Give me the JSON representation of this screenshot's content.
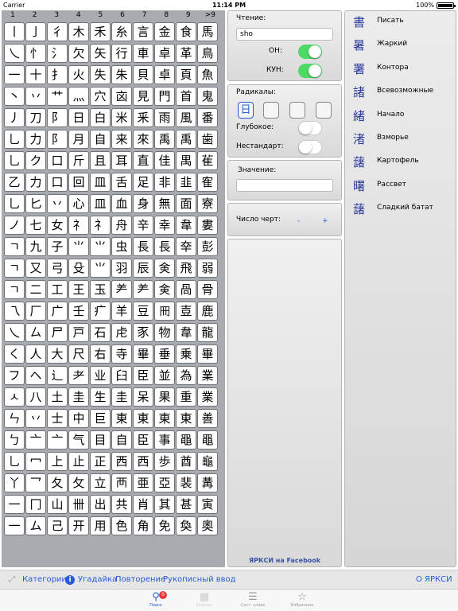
{
  "status": {
    "carrier": "Carrier",
    "time": "11:14 PM",
    "battery": "100%"
  },
  "stroke_header": [
    "1",
    "2",
    "3",
    "4",
    "5",
    "6",
    "7",
    "8",
    "9",
    ">9"
  ],
  "grid": [
    [
      "丨",
      "亅",
      "彳",
      "木",
      "禾",
      "糸",
      "言",
      "金",
      "食",
      "馬"
    ],
    [
      "乀",
      "忄",
      "氵",
      "欠",
      "矢",
      "行",
      "車",
      "卓",
      "革",
      "鳥"
    ],
    [
      "一",
      "十",
      "扌",
      "火",
      "失",
      "朱",
      "貝",
      "卓",
      "頁",
      "魚"
    ],
    [
      "丶",
      "丷",
      "艹",
      "灬",
      "穴",
      "㐫",
      "見",
      "門",
      "首",
      "鬼"
    ],
    [
      "丿",
      "刀",
      "阝",
      "日",
      "白",
      "米",
      "釆",
      "雨",
      "風",
      "番"
    ],
    [
      "乚",
      "力",
      "阝",
      "月",
      "自",
      "来",
      "來",
      "禹",
      "禹",
      "歯"
    ],
    [
      "乚",
      "ク",
      "口",
      "斤",
      "且",
      "耳",
      "直",
      "佳",
      "禺",
      "雈"
    ],
    [
      "乙",
      "力",
      "口",
      "回",
      "皿",
      "舌",
      "足",
      "非",
      "韭",
      "隺"
    ],
    [
      "乚",
      "匕",
      "丷",
      "心",
      "皿",
      "血",
      "身",
      "無",
      "面",
      "寮"
    ],
    [
      "ノ",
      "七",
      "女",
      "礻",
      "礻",
      "舟",
      "辛",
      "幸",
      "韋",
      "婁"
    ],
    [
      "ㄱ",
      "九",
      "子",
      "⺌",
      "⺌",
      "虫",
      "長",
      "長",
      "㚔",
      "彭"
    ],
    [
      "ㄱ",
      "又",
      "弓",
      "殳",
      "⺌",
      "羽",
      "辰",
      "㑒",
      "飛",
      "弱"
    ],
    [
      "ㄱ",
      "二",
      "工",
      "王",
      "玉",
      "⺶",
      "⺶",
      "㑒",
      "咼",
      "骨"
    ],
    [
      "乁",
      "厂",
      "广",
      "壬",
      "疒",
      "羊",
      "豆",
      "𠕁",
      "壴",
      "鹿"
    ],
    [
      "乀",
      "ㄙ",
      "尸",
      "戸",
      "石",
      "虍",
      "豕",
      "物",
      "韋",
      "龍"
    ],
    [
      "く",
      "人",
      "大",
      "尺",
      "右",
      "寺",
      "畢",
      "垂",
      "乗",
      "畢"
    ],
    [
      "フ",
      "ヘ",
      "辶",
      "耂",
      "业",
      "臼",
      "臣",
      "並",
      "為",
      "業"
    ],
    [
      "ㅅ",
      "八",
      "土",
      "圭",
      "生",
      "圭",
      "呆",
      "果",
      "重",
      "業"
    ],
    [
      "ㄣ",
      "丷",
      "士",
      "中",
      "巨",
      "東",
      "東",
      "東",
      "東",
      "善"
    ],
    [
      "ㄅ",
      "亠",
      "亠",
      "气",
      "目",
      "自",
      "臣",
      "事",
      "黽",
      "黽"
    ],
    [
      "乚",
      "冖",
      "上",
      "止",
      "正",
      "西",
      "西",
      "歩",
      "酋",
      "龜"
    ],
    [
      "丫",
      "乛",
      "夂",
      "攵",
      "立",
      "襾",
      "亜",
      "亞",
      "裴",
      "冓"
    ],
    [
      "一",
      "冂",
      "山",
      "卌",
      "出",
      "共",
      "肖",
      "其",
      "甚",
      "寅"
    ],
    [
      "一",
      "ム",
      "己",
      "开",
      "用",
      "色",
      "角",
      "免",
      "奐",
      "奧"
    ]
  ],
  "reading": {
    "label": "Чтение:",
    "value": "sho",
    "on_label": "ОН:",
    "kun_label": "КУН:"
  },
  "radicals": {
    "label": "Радикалы:",
    "slots": [
      "日",
      "",
      "",
      ""
    ],
    "deep_label": "Глубокое:",
    "nonstandard_label": "Нестандарт:"
  },
  "meaning": {
    "label": "Значение:",
    "value": ""
  },
  "strokes": {
    "label": "Число черт:",
    "minus": "-",
    "plus": "+"
  },
  "facebook": "ЯРКСИ на Facebook",
  "results": [
    {
      "kanji": "書",
      "meaning": "Писать"
    },
    {
      "kanji": "暑",
      "meaning": "Жаркий"
    },
    {
      "kanji": "署",
      "meaning": "Контора"
    },
    {
      "kanji": "諸",
      "meaning": "Всевозможные"
    },
    {
      "kanji": "緒",
      "meaning": "Начало"
    },
    {
      "kanji": "渚",
      "meaning": "Взморье"
    },
    {
      "kanji": "藷",
      "meaning": "Картофель"
    },
    {
      "kanji": "曙",
      "meaning": "Рассвет"
    },
    {
      "kanji": "藷",
      "meaning": "Сладкий батат"
    }
  ],
  "navbar": {
    "categories": "Категории",
    "guess": "Угадайка",
    "repeat": "Повторение",
    "handwriting": "Рукописный ввод",
    "about": "О ЯРКСИ"
  },
  "tabs": [
    {
      "label": "Поиск",
      "badge": "0"
    },
    {
      "label": "Результ",
      "badge": ""
    },
    {
      "label": "Сост. слова",
      "badge": ""
    },
    {
      "label": "Избранное",
      "badge": ""
    }
  ],
  "colors": {
    "accent": "#2a5bd7",
    "switch_on": "#4cd964",
    "kanji": "#2b3a9c"
  }
}
